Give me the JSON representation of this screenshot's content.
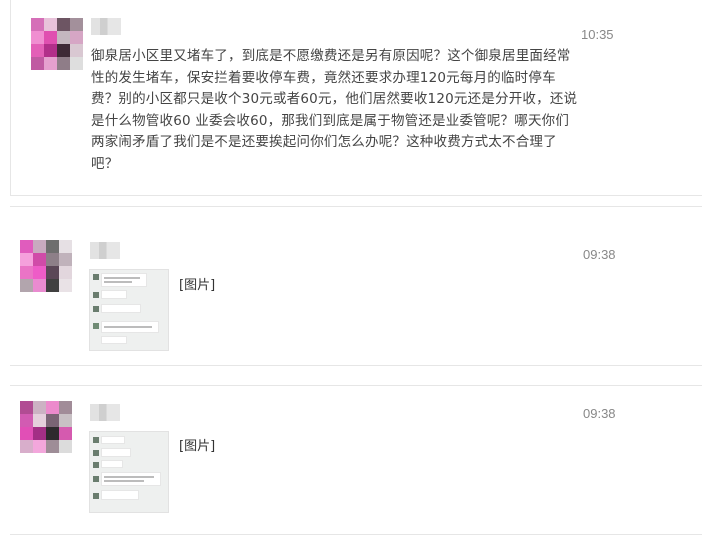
{
  "messages": [
    {
      "nickname": "",
      "time": "10:35",
      "content_lines": [
        "御泉居小区里又堵车了，到底是不愿缴费还是另有原因呢？这个御泉居里面经常",
        "性的发生堵车，保安拦着要收停车费，竟然还要求办理120元每月的临时停车",
        "费？别的小区都只是收个30元或者60元，他们居然要收120元还是分开收，还说",
        "是什么物管收60 业委会收60，那我们到底是属于物管还是业委管呢？哪天你们",
        "两家闹矛盾了我们是不是还要挨起问你们怎么办呢？这种收费方式太不合理了",
        "吧？"
      ],
      "avatar_colors": [
        "#d56fb8",
        "#e8c2da",
        "#6d5563",
        "#a3909b",
        "#f08ed1",
        "#e04fb0",
        "#c4b7bf",
        "#d6a6c5",
        "#e35fb7",
        "#b22f8a",
        "#3e2a36",
        "#d9c8d2",
        "#c05aa2",
        "#e6a0cf",
        "#8f7d88",
        "#dedede"
      ]
    },
    {
      "nickname": "",
      "time": "09:38",
      "image_label": "[图片]",
      "avatar_colors": [
        "#e05cbd",
        "#c8aabf",
        "#6e6e6e",
        "#e6e0e4",
        "#f5a0dc",
        "#d04ba8",
        "#8d7f88",
        "#c0b2bb",
        "#ea74c6",
        "#ee5cc7",
        "#5b4757",
        "#e2d6dd",
        "#b2a5ad",
        "#e98bd0",
        "#404040",
        "#e9e2e6"
      ]
    },
    {
      "nickname": "",
      "time": "09:38",
      "image_label": "[图片]",
      "avatar_colors": [
        "#b14c93",
        "#ccb2c3",
        "#ec8acc",
        "#a18c98",
        "#d25bb2",
        "#e5cfdc",
        "#7b6475",
        "#c8c0c4",
        "#e14fb6",
        "#a32f85",
        "#2e2a2d",
        "#d55aaf",
        "#d8aecb",
        "#f3a7dc",
        "#9e8d97",
        "#dcdcdc"
      ]
    }
  ]
}
